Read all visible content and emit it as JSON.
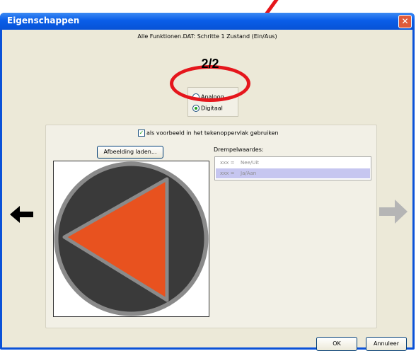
{
  "window": {
    "title": "Eigenschappen",
    "close_glyph": "✕"
  },
  "header": {
    "subtitle": "Alle Funktionen.DAT: Schritte 1 Zustand (Ein/Aus)",
    "counter": "2/2"
  },
  "mode": {
    "options": [
      "Analoog",
      "Digitaal"
    ],
    "selected": "Digitaal"
  },
  "panel": {
    "preview_checkbox_label": "als voorbeeld in het tekenoppervlak gebruiken",
    "preview_checked": true,
    "load_image_button": "Afbeelding laden...",
    "threshold_label": "Drempelwaardes:",
    "thresholds": [
      {
        "key": "xxx =",
        "value": "Nee/Uit",
        "selected": false
      },
      {
        "key": "xxx =",
        "value": "Ja/Aan",
        "selected": true
      }
    ]
  },
  "image": {
    "circle_color": "#3a3a3a",
    "ring_color": "#8a8a8a",
    "triangle_color": "#e8521f"
  },
  "annotation": {
    "color": "#e5161c"
  },
  "navigation": {
    "prev_icon": "arrow-left-icon",
    "next_icon": "arrow-right-icon",
    "next_enabled": false
  },
  "footer": {
    "ok_label": "OK",
    "cancel_label": "Annuleer"
  }
}
